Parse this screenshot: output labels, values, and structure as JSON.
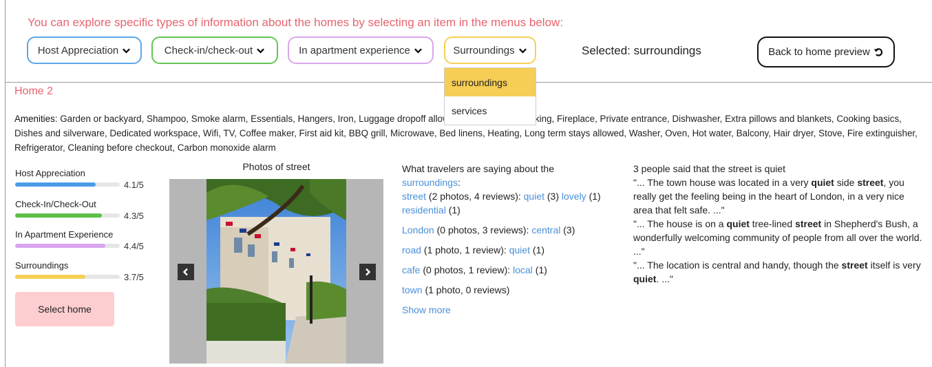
{
  "intro": "You can explore specific types of information about the homes by selecting an item in the menus below:",
  "menus": [
    {
      "label": "Host Appreciation",
      "color": "#5aa7e8"
    },
    {
      "label": "Check-in/check-out",
      "color": "#64c452"
    },
    {
      "label": "In apartment experience",
      "color": "#d9a5ee"
    },
    {
      "label": "Surroundings",
      "color": "#f6cf55"
    }
  ],
  "dropdown": [
    "surroundings",
    "services"
  ],
  "selected": "Selected: surroundings",
  "back_button": "Back to home preview",
  "home_title": "Home 2",
  "amenities_label": "Amenities:",
  "amenities_text": " Garden or backyard, Shampoo, Smoke alarm, Essentials, Hangers, Iron, Luggage dropoff allowed, Kitchen, Paid parking, Fireplace, Private entrance, Dishwasher, Extra pillows and blankets, Cooking basics, Dishes and silverware, Dedicated workspace, Wifi, TV, Coffee maker, First aid kit, BBQ grill, Microwave, Bed linens, Heating, Long term stays allowed, Washer, Oven, Hot water, Balcony, Hair dryer, Stove, Fire extinguisher, Refrigerator, Cleaning before checkout, Carbon monoxide alarm",
  "scores": [
    {
      "label": "Host Appreciation",
      "value": "4.1/5",
      "fraction": 0.77,
      "color": "#4a9be8"
    },
    {
      "label": "Check-In/Check-Out",
      "value": "4.3/5",
      "fraction": 0.83,
      "color": "#5dbf47"
    },
    {
      "label": "In Apartment Experience",
      "value": "4.4/5",
      "fraction": 0.86,
      "color": "#d9a5ee"
    },
    {
      "label": "Surroundings",
      "value": "3.7/5",
      "fraction": 0.67,
      "color": "#f6cf55"
    }
  ],
  "select_home": "Select home",
  "photos_title": "Photos of street",
  "travelers": {
    "heading": "What travelers are saying about the",
    "heading_kw": "surroundings",
    "items": [
      {
        "kw": "street",
        "counts": " (2 photos, 4 reviews): ",
        "tags": [
          {
            "t": "quiet",
            "n": " (3) "
          },
          {
            "t": "lovely",
            "n": " (1) "
          },
          {
            "t": "residential",
            "n": " (1)"
          }
        ]
      },
      {
        "kw": "London",
        "counts": " (0 photos, 3 reviews): ",
        "tags": [
          {
            "t": "central",
            "n": " (3)"
          }
        ]
      },
      {
        "kw": "road",
        "counts": " (1 photo, 1 review): ",
        "tags": [
          {
            "t": "quiet",
            "n": " (1)"
          }
        ]
      },
      {
        "kw": "cafe",
        "counts": " (0 photos, 1 review): ",
        "tags": [
          {
            "t": "local",
            "n": " (1)"
          }
        ]
      },
      {
        "kw": "town",
        "counts": " (1 photo, 0 reviews)",
        "tags": []
      }
    ],
    "show_more": "Show more"
  },
  "quotes": {
    "heading": "3 people said that the street is quiet",
    "items": [
      [
        "\"... The town house was located in a very ",
        "quiet",
        " side ",
        "street",
        ", you really get the feeling being in the heart of London, in a very nice area that felt safe. ...\""
      ],
      [
        "\"... The house is on a ",
        "quiet",
        " tree-lined ",
        "street",
        " in Shepherd's Bush, a wonderfully welcoming community of people from all over the world. ...\""
      ],
      [
        "\"... The location is central and handy, though the ",
        "street",
        " itself is very ",
        "quiet",
        ". ...\""
      ]
    ]
  }
}
